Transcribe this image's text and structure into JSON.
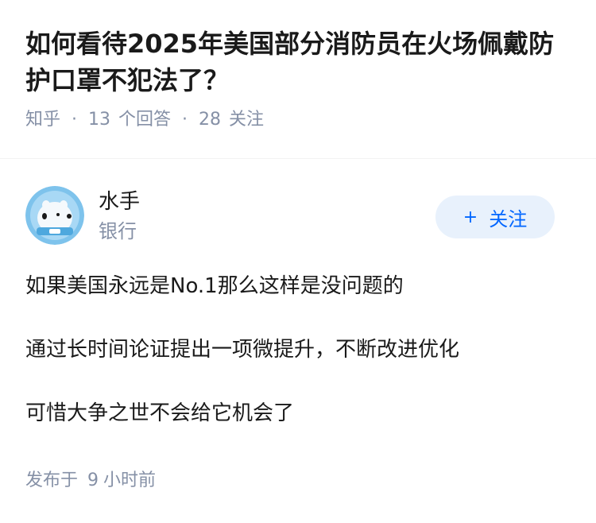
{
  "question": {
    "title": "如何看待2025年美国部分消防员在火场佩戴防护口罩不犯法了？",
    "source": "知乎",
    "separator": "·",
    "answers_count": "13",
    "answers_label": "个回答",
    "followers_count": "28",
    "followers_label": "关注"
  },
  "author": {
    "name": "水手",
    "tag": "银行",
    "avatar_icon": "polar-bear-astronaut-avatar",
    "follow_plus": "+",
    "follow_label": "关注"
  },
  "answer": {
    "paragraphs": [
      "如果美国永远是No.1那么这样是没问题的",
      "通过长时间论证提出一项微提升，不断改进优化",
      "可惜大争之世不会给它机会了"
    ]
  },
  "footer": {
    "published_prefix": "发布于",
    "published_num": "9",
    "published_unit": "小时前"
  },
  "colors": {
    "title": "#1a1a1a",
    "meta": "#8590a6",
    "accent": "#0066ff",
    "follow_bg": "#e8f1fc"
  }
}
